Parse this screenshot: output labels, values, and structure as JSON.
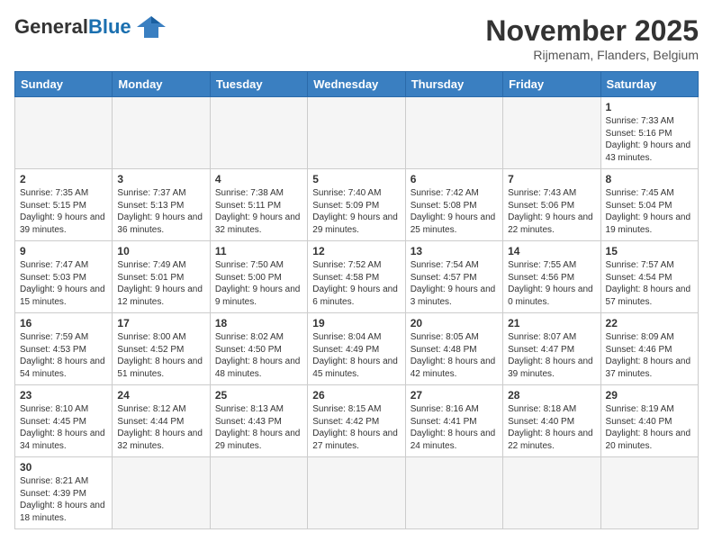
{
  "logo": {
    "general": "General",
    "blue": "Blue"
  },
  "title": "November 2025",
  "subtitle": "Rijmenam, Flanders, Belgium",
  "headers": [
    "Sunday",
    "Monday",
    "Tuesday",
    "Wednesday",
    "Thursday",
    "Friday",
    "Saturday"
  ],
  "weeks": [
    [
      {
        "day": "",
        "info": ""
      },
      {
        "day": "",
        "info": ""
      },
      {
        "day": "",
        "info": ""
      },
      {
        "day": "",
        "info": ""
      },
      {
        "day": "",
        "info": ""
      },
      {
        "day": "",
        "info": ""
      },
      {
        "day": "1",
        "info": "Sunrise: 7:33 AM\nSunset: 5:16 PM\nDaylight: 9 hours and 43 minutes."
      }
    ],
    [
      {
        "day": "2",
        "info": "Sunrise: 7:35 AM\nSunset: 5:15 PM\nDaylight: 9 hours and 39 minutes."
      },
      {
        "day": "3",
        "info": "Sunrise: 7:37 AM\nSunset: 5:13 PM\nDaylight: 9 hours and 36 minutes."
      },
      {
        "day": "4",
        "info": "Sunrise: 7:38 AM\nSunset: 5:11 PM\nDaylight: 9 hours and 32 minutes."
      },
      {
        "day": "5",
        "info": "Sunrise: 7:40 AM\nSunset: 5:09 PM\nDaylight: 9 hours and 29 minutes."
      },
      {
        "day": "6",
        "info": "Sunrise: 7:42 AM\nSunset: 5:08 PM\nDaylight: 9 hours and 25 minutes."
      },
      {
        "day": "7",
        "info": "Sunrise: 7:43 AM\nSunset: 5:06 PM\nDaylight: 9 hours and 22 minutes."
      },
      {
        "day": "8",
        "info": "Sunrise: 7:45 AM\nSunset: 5:04 PM\nDaylight: 9 hours and 19 minutes."
      }
    ],
    [
      {
        "day": "9",
        "info": "Sunrise: 7:47 AM\nSunset: 5:03 PM\nDaylight: 9 hours and 15 minutes."
      },
      {
        "day": "10",
        "info": "Sunrise: 7:49 AM\nSunset: 5:01 PM\nDaylight: 9 hours and 12 minutes."
      },
      {
        "day": "11",
        "info": "Sunrise: 7:50 AM\nSunset: 5:00 PM\nDaylight: 9 hours and 9 minutes."
      },
      {
        "day": "12",
        "info": "Sunrise: 7:52 AM\nSunset: 4:58 PM\nDaylight: 9 hours and 6 minutes."
      },
      {
        "day": "13",
        "info": "Sunrise: 7:54 AM\nSunset: 4:57 PM\nDaylight: 9 hours and 3 minutes."
      },
      {
        "day": "14",
        "info": "Sunrise: 7:55 AM\nSunset: 4:56 PM\nDaylight: 9 hours and 0 minutes."
      },
      {
        "day": "15",
        "info": "Sunrise: 7:57 AM\nSunset: 4:54 PM\nDaylight: 8 hours and 57 minutes."
      }
    ],
    [
      {
        "day": "16",
        "info": "Sunrise: 7:59 AM\nSunset: 4:53 PM\nDaylight: 8 hours and 54 minutes."
      },
      {
        "day": "17",
        "info": "Sunrise: 8:00 AM\nSunset: 4:52 PM\nDaylight: 8 hours and 51 minutes."
      },
      {
        "day": "18",
        "info": "Sunrise: 8:02 AM\nSunset: 4:50 PM\nDaylight: 8 hours and 48 minutes."
      },
      {
        "day": "19",
        "info": "Sunrise: 8:04 AM\nSunset: 4:49 PM\nDaylight: 8 hours and 45 minutes."
      },
      {
        "day": "20",
        "info": "Sunrise: 8:05 AM\nSunset: 4:48 PM\nDaylight: 8 hours and 42 minutes."
      },
      {
        "day": "21",
        "info": "Sunrise: 8:07 AM\nSunset: 4:47 PM\nDaylight: 8 hours and 39 minutes."
      },
      {
        "day": "22",
        "info": "Sunrise: 8:09 AM\nSunset: 4:46 PM\nDaylight: 8 hours and 37 minutes."
      }
    ],
    [
      {
        "day": "23",
        "info": "Sunrise: 8:10 AM\nSunset: 4:45 PM\nDaylight: 8 hours and 34 minutes."
      },
      {
        "day": "24",
        "info": "Sunrise: 8:12 AM\nSunset: 4:44 PM\nDaylight: 8 hours and 32 minutes."
      },
      {
        "day": "25",
        "info": "Sunrise: 8:13 AM\nSunset: 4:43 PM\nDaylight: 8 hours and 29 minutes."
      },
      {
        "day": "26",
        "info": "Sunrise: 8:15 AM\nSunset: 4:42 PM\nDaylight: 8 hours and 27 minutes."
      },
      {
        "day": "27",
        "info": "Sunrise: 8:16 AM\nSunset: 4:41 PM\nDaylight: 8 hours and 24 minutes."
      },
      {
        "day": "28",
        "info": "Sunrise: 8:18 AM\nSunset: 4:40 PM\nDaylight: 8 hours and 22 minutes."
      },
      {
        "day": "29",
        "info": "Sunrise: 8:19 AM\nSunset: 4:40 PM\nDaylight: 8 hours and 20 minutes."
      }
    ],
    [
      {
        "day": "30",
        "info": "Sunrise: 8:21 AM\nSunset: 4:39 PM\nDaylight: 8 hours and 18 minutes."
      },
      {
        "day": "",
        "info": ""
      },
      {
        "day": "",
        "info": ""
      },
      {
        "day": "",
        "info": ""
      },
      {
        "day": "",
        "info": ""
      },
      {
        "day": "",
        "info": ""
      },
      {
        "day": "",
        "info": ""
      }
    ]
  ]
}
